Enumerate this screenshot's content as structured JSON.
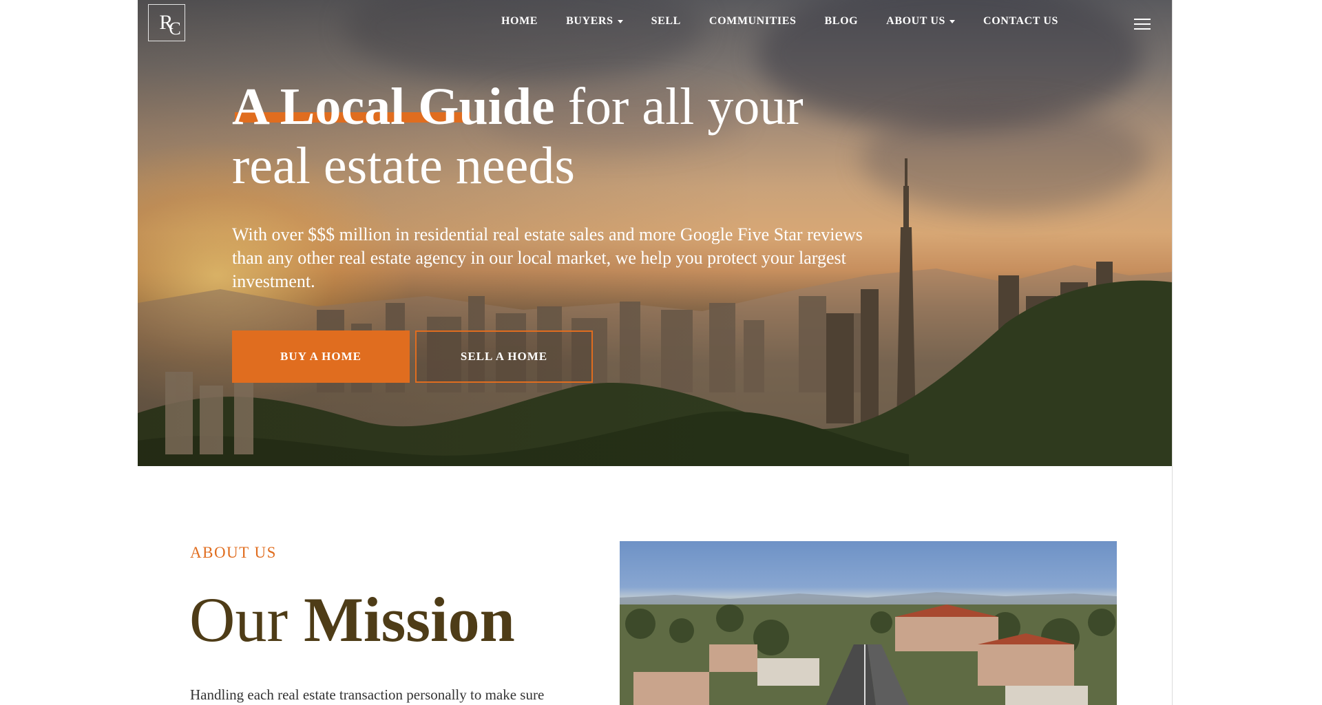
{
  "brand": {
    "logo_text_r": "R",
    "logo_text_c": "C"
  },
  "nav": {
    "items": [
      {
        "label": "HOME",
        "has_dropdown": false
      },
      {
        "label": "BUYERS",
        "has_dropdown": true
      },
      {
        "label": "SELL",
        "has_dropdown": false
      },
      {
        "label": "COMMUNITIES",
        "has_dropdown": false
      },
      {
        "label": "BLOG",
        "has_dropdown": false
      },
      {
        "label": "ABOUT US",
        "has_dropdown": true
      },
      {
        "label": "CONTACT US",
        "has_dropdown": false
      }
    ],
    "menu_icon": "hamburger-menu-icon"
  },
  "hero": {
    "headline_bold": "A Local Guide",
    "headline_rest_line1": " for all your",
    "headline_line2": "real estate needs",
    "subtext": "With over $$$ million in residential real estate sales and more Google Five Star reviews than any other real estate agency in our local market, we help you protect your largest investment.",
    "buttons": {
      "buy": "BUY A HOME",
      "sell": "SELL A HOME"
    }
  },
  "about": {
    "eyebrow": "ABOUT US",
    "title_regular": "Our ",
    "title_bold": "Mission",
    "body": "Handling each real estate transaction personally to make sure"
  },
  "colors": {
    "accent": "#e06d1f",
    "title_brown": "#4e3c17",
    "white": "#ffffff"
  }
}
